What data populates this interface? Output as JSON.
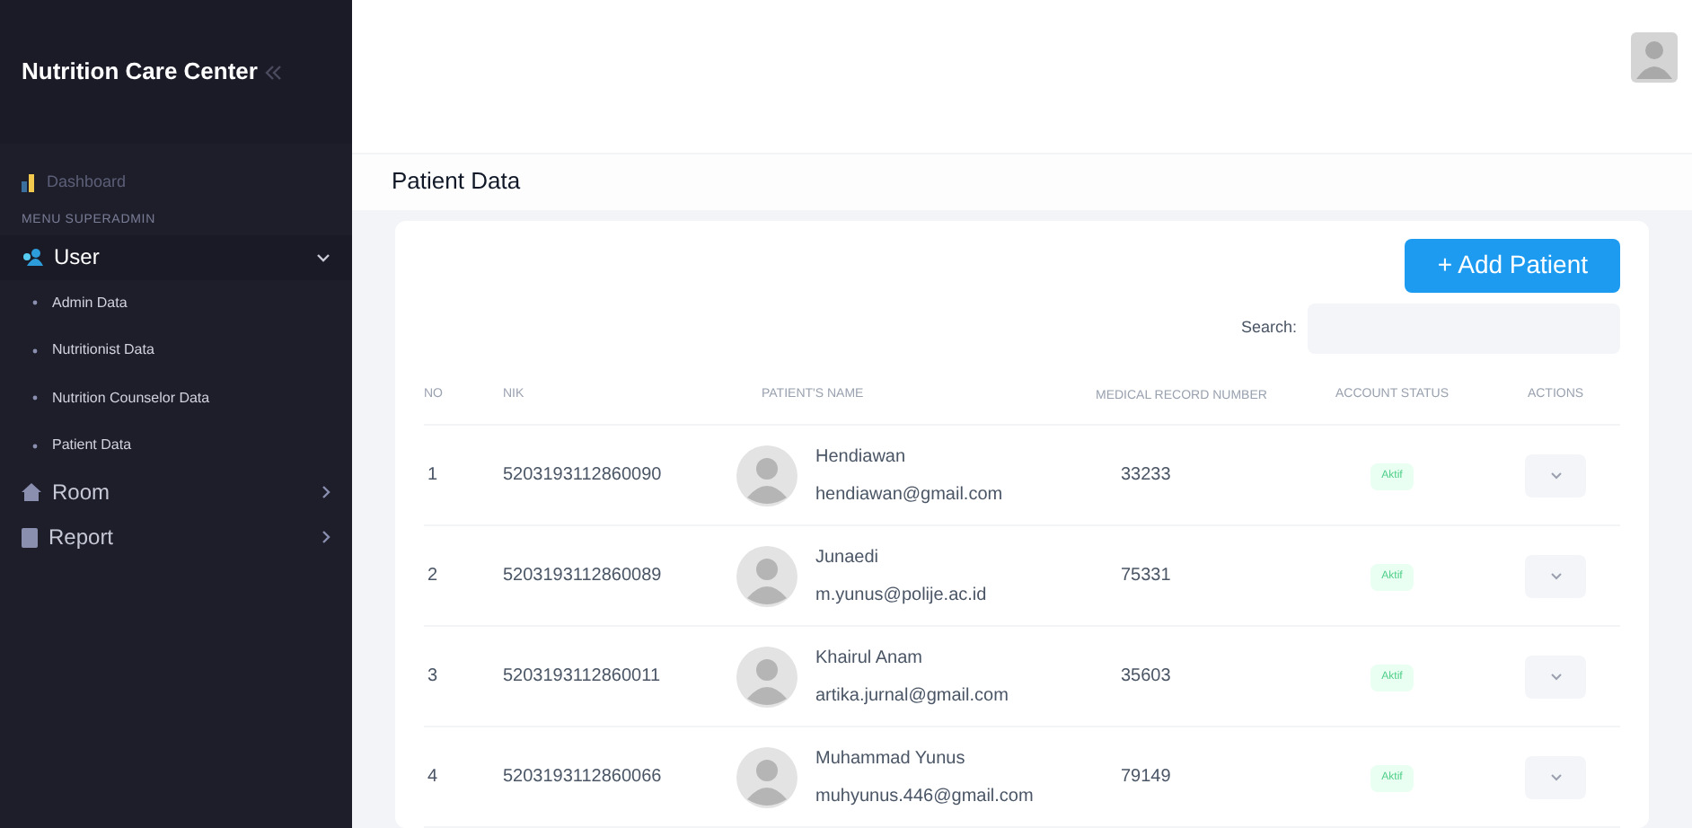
{
  "sidebar": {
    "title": "Nutrition Care Center",
    "items": [
      {
        "label": "Dashboard",
        "kind": "link",
        "selected": false
      },
      {
        "label": "MENU SUPERADMIN",
        "kind": "heading"
      },
      {
        "label": "User",
        "kind": "group",
        "selected": true,
        "expanded": true,
        "children": [
          {
            "label": "Admin Data",
            "selected": false
          },
          {
            "label": "Nutritionist Data",
            "selected": false
          },
          {
            "label": "Nutrition Counselor Data",
            "selected": false
          },
          {
            "label": "Patient Data",
            "selected": false
          }
        ]
      },
      {
        "label": "Room",
        "kind": "group",
        "selected": false,
        "expanded": false
      },
      {
        "label": "Report",
        "kind": "group",
        "selected": false,
        "expanded": false
      }
    ]
  },
  "page_title": "Patient Data",
  "add_button": "+ Add Patient",
  "search": {
    "label": "Search:"
  },
  "table": {
    "columns": [
      "NO",
      "NIK",
      "PATIENT'S NAME",
      "MEDICAL RECORD NUMBER",
      "ACCOUNT STATUS",
      "ACTIONS"
    ],
    "rows": [
      {
        "no": "1",
        "nik": "5203193112860090",
        "name": "Hendiawan",
        "email": "hendiawan@gmail.com",
        "record": "33233",
        "status": "Aktif"
      },
      {
        "no": "2",
        "nik": "5203193112860089",
        "name": "Junaedi",
        "email": "m.yunus@polije.ac.id",
        "record": "75331",
        "status": "Aktif"
      },
      {
        "no": "3",
        "nik": "5203193112860011",
        "name": "Khairul Anam",
        "email": "artika.jurnal@gmail.com",
        "record": "35603",
        "status": "Aktif"
      },
      {
        "no": "4",
        "nik": "5203193112860066",
        "name": "Muhammad Yunus",
        "email": "muhyunus.446@gmail.com",
        "record": "79149",
        "status": "Aktif"
      }
    ]
  }
}
